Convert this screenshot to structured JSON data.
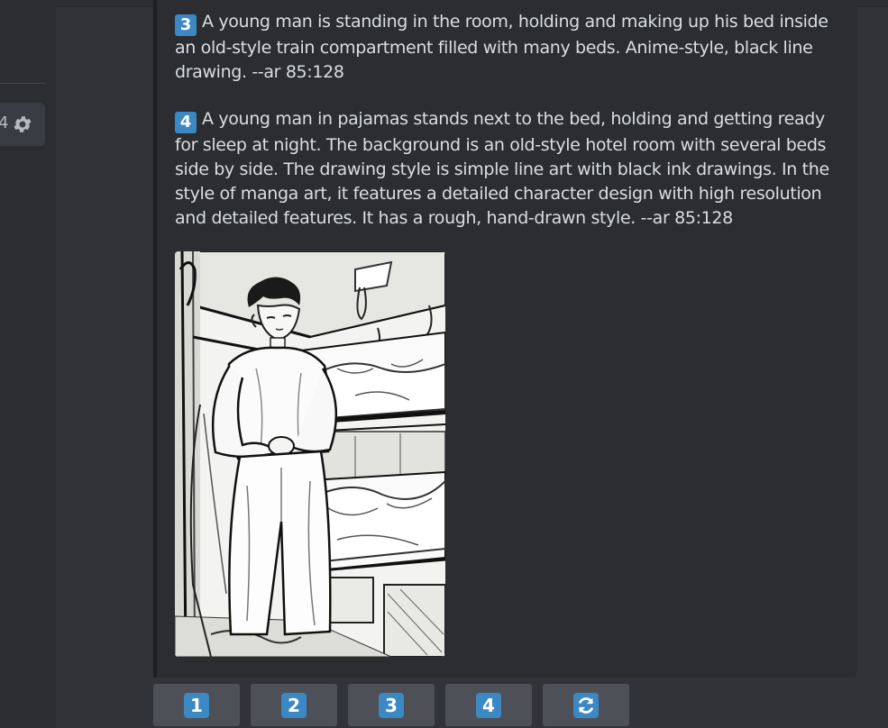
{
  "sidebar": {
    "partial_icon": "4",
    "gear_icon": "gear-icon"
  },
  "message": {
    "prompts": [
      {
        "number": "3",
        "text": "A young man is standing in the room, holding and making up his bed inside an old-style train compartment filled with many beds. Anime-style, black line drawing. --ar 85:128"
      },
      {
        "number": "4",
        "text": "A young man in pajamas stands next to the bed, holding and getting ready for sleep at night. The background is an old-style hotel room with several beds side by side. The drawing style is simple line art with black ink drawings. In the style of manga art, it features a detailed character design with high resolution and detailed features. It has a rough, hand-drawn style. --ar 85:128"
      }
    ],
    "image": {
      "subject": "manga-style line art of young man in pajamas beside bunk beds"
    }
  },
  "buttons": [
    {
      "label": "1"
    },
    {
      "label": "2"
    },
    {
      "label": "3"
    },
    {
      "label": "4"
    },
    {
      "label": "",
      "icon": "refresh-icon"
    }
  ],
  "colors": {
    "background": "#313338",
    "embed": "#2b2d31",
    "button": "#4e5058",
    "keycap": "#3b88c3",
    "text": "#dbdee1"
  }
}
